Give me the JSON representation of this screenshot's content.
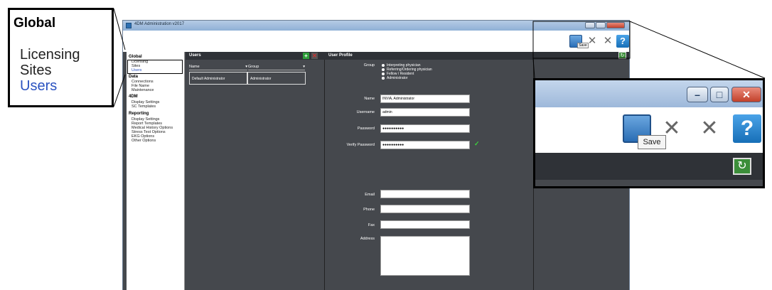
{
  "window": {
    "title": "4DM Administration v2017",
    "toolbar": {
      "save_tooltip": "Save",
      "help_symbol": "?"
    }
  },
  "nav": {
    "sections": [
      {
        "heading": "Global",
        "items": [
          "Licensing",
          "Sites",
          "Users"
        ]
      },
      {
        "heading": "Data",
        "items": [
          "Connections",
          "File Name",
          "Maintenance"
        ]
      },
      {
        "heading": "4DM",
        "items": [
          "Display Settings",
          "SC Templates"
        ]
      },
      {
        "heading": "Reporting",
        "items": [
          "Display Settings",
          "Report Templates",
          "Medical History Options",
          "Stress Test Options",
          "EKG Options",
          "Other Options"
        ]
      }
    ],
    "active": "Users"
  },
  "users": {
    "title": "Users",
    "columns": [
      "Name",
      "Group"
    ],
    "rows": [
      {
        "name": "Default Administrator",
        "group": "Administrator"
      }
    ]
  },
  "profile": {
    "title": "User Profile",
    "group_label": "Group",
    "group_options": [
      "Interpreting physician",
      "Referring/Ordering physician",
      "Fellow / Resident",
      "Administrator"
    ],
    "group_selected": "Administrator",
    "name_label": "Name",
    "name_value": "INVIA, Administrator",
    "username_label": "Username",
    "username_value": "admin",
    "password_label": "Password",
    "password_value": "●●●●●●●●●●",
    "verify_label": "Verify Password",
    "verify_value": "●●●●●●●●●●",
    "verify_ok": "✓",
    "email_label": "Email",
    "phone_label": "Phone",
    "fax_label": "Fax",
    "address_label": "Address"
  },
  "callout_left": {
    "heading": "Global",
    "items": [
      "Licensing",
      "Sites",
      "Users"
    ]
  },
  "callout_right": {
    "tooltip": "Save",
    "help_symbol": "?"
  }
}
